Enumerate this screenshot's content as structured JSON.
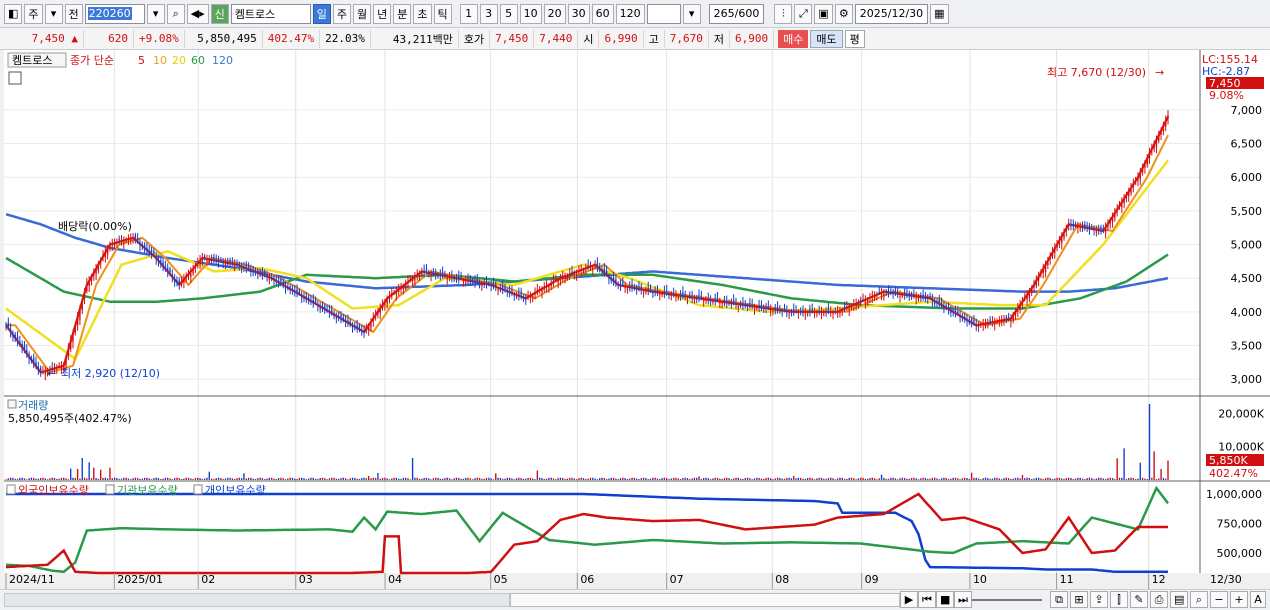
{
  "toolbar": {
    "market": "주",
    "prev": "전",
    "code": "220260",
    "stock_name": "켐트로스",
    "stock_badge": "신",
    "periods": [
      "일",
      "주",
      "월",
      "년",
      "분",
      "초",
      "틱"
    ],
    "selected_period": "일",
    "intervals": [
      "1",
      "3",
      "5",
      "10",
      "20",
      "30",
      "60",
      "120"
    ],
    "count": "265",
    "count_max": "/600",
    "date": "2025/12/30"
  },
  "quote": {
    "price": "7,450 ▲",
    "change": "620",
    "change_pct": "+9.08%",
    "volume": "5,850,495",
    "vol_ratio": "402.47%",
    "turnover": "22.03%",
    "amount": "43,211백만",
    "bid_label": "호가",
    "ask": "7,450",
    "bid": "7,440",
    "open_label": "시",
    "open": "6,990",
    "high_label": "고",
    "high": "7,670",
    "low_label": "저",
    "low": "6,900",
    "buy": "매수",
    "sell": "매도",
    "avg": "평"
  },
  "chart_data": {
    "type": "candlestick",
    "price_panel": {
      "legend": {
        "name": "켐트로스",
        "ma_label": "종가 단순",
        "ma_periods": [
          "5",
          "10",
          "20",
          "60",
          "120"
        ]
      },
      "y_ticks": [
        3000,
        3500,
        4000,
        4500,
        5000,
        5500,
        6000,
        6500,
        7000
      ],
      "ylim": [
        2750,
        7800
      ],
      "dividend_label": "배당락(0.00%)",
      "high_annotation": "최고 7,670 (12/30)",
      "low_annotation": "최저 2,920 (12/10)",
      "lc_label": "LC:155.14",
      "hc_label": "HC:-2.87",
      "last_price_label": "7,450",
      "last_pct_label": "9.08%",
      "ma5_anchors": [
        [
          0,
          3800
        ],
        [
          15,
          3100
        ],
        [
          25,
          3200
        ],
        [
          35,
          4400
        ],
        [
          45,
          5000
        ],
        [
          55,
          5100
        ],
        [
          65,
          4800
        ],
        [
          75,
          4400
        ],
        [
          85,
          4800
        ],
        [
          100,
          4700
        ],
        [
          115,
          4500
        ],
        [
          125,
          4300
        ],
        [
          140,
          4000
        ],
        [
          155,
          3700
        ],
        [
          165,
          4200
        ],
        [
          180,
          4600
        ],
        [
          195,
          4500
        ],
        [
          210,
          4400
        ],
        [
          225,
          4200
        ],
        [
          240,
          4500
        ],
        [
          255,
          4700
        ],
        [
          265,
          4400
        ],
        [
          280,
          4300
        ],
        [
          300,
          4200
        ],
        [
          320,
          4100
        ],
        [
          340,
          4000
        ],
        [
          360,
          4000
        ],
        [
          380,
          4300
        ],
        [
          400,
          4200
        ],
        [
          420,
          3800
        ],
        [
          435,
          3900
        ],
        [
          445,
          4400
        ],
        [
          460,
          5300
        ],
        [
          475,
          5200
        ],
        [
          490,
          6000
        ],
        [
          503,
          6900
        ]
      ],
      "ma20_anchors": [
        [
          0,
          4050
        ],
        [
          30,
          3300
        ],
        [
          50,
          4700
        ],
        [
          70,
          4900
        ],
        [
          90,
          4600
        ],
        [
          110,
          4650
        ],
        [
          130,
          4500
        ],
        [
          150,
          4050
        ],
        [
          170,
          4100
        ],
        [
          190,
          4500
        ],
        [
          220,
          4400
        ],
        [
          250,
          4700
        ],
        [
          270,
          4500
        ],
        [
          300,
          4100
        ],
        [
          330,
          4000
        ],
        [
          360,
          4050
        ],
        [
          400,
          4150
        ],
        [
          430,
          4100
        ],
        [
          450,
          4100
        ],
        [
          475,
          5000
        ],
        [
          503,
          6250
        ]
      ],
      "ma60_anchors": [
        [
          0,
          4800
        ],
        [
          25,
          4300
        ],
        [
          45,
          4150
        ],
        [
          65,
          4150
        ],
        [
          85,
          4200
        ],
        [
          110,
          4300
        ],
        [
          130,
          4550
        ],
        [
          160,
          4500
        ],
        [
          190,
          4550
        ],
        [
          220,
          4450
        ],
        [
          250,
          4550
        ],
        [
          280,
          4550
        ],
        [
          310,
          4400
        ],
        [
          340,
          4200
        ],
        [
          370,
          4100
        ],
        [
          410,
          4050
        ],
        [
          440,
          4050
        ],
        [
          465,
          4200
        ],
        [
          485,
          4450
        ],
        [
          503,
          4850
        ]
      ],
      "ma120_anchors": [
        [
          0,
          5450
        ],
        [
          15,
          5300
        ],
        [
          30,
          5100
        ],
        [
          45,
          4950
        ],
        [
          70,
          4800
        ],
        [
          100,
          4650
        ],
        [
          130,
          4450
        ],
        [
          160,
          4350
        ],
        [
          200,
          4400
        ],
        [
          240,
          4500
        ],
        [
          280,
          4600
        ],
        [
          320,
          4500
        ],
        [
          360,
          4400
        ],
        [
          400,
          4350
        ],
        [
          440,
          4300
        ],
        [
          460,
          4300
        ],
        [
          480,
          4350
        ],
        [
          503,
          4500
        ]
      ]
    },
    "volume_panel": {
      "title": "거래량",
      "value_label": "5,850,495주(402.47%)",
      "y_ticks": [
        10000,
        20000
      ],
      "y_tick_labels": [
        "10,000K",
        "20,000K"
      ],
      "last_label": "5,850K",
      "last_pct_label": "402.47%",
      "ylim": [
        0,
        24000
      ],
      "spikes": [
        [
          28,
          3400
        ],
        [
          31,
          3300
        ],
        [
          33,
          6600
        ],
        [
          36,
          5300
        ],
        [
          38,
          3700
        ],
        [
          41,
          3100
        ],
        [
          45,
          3700
        ],
        [
          88,
          2500
        ],
        [
          103,
          2000
        ],
        [
          161,
          2100
        ],
        [
          157,
          1200
        ],
        [
          176,
          6600
        ],
        [
          212,
          2000
        ],
        [
          230,
          2800
        ],
        [
          300,
          1100
        ],
        [
          341,
          1200
        ],
        [
          379,
          1600
        ],
        [
          418,
          2200
        ],
        [
          440,
          1500
        ],
        [
          481,
          6500
        ],
        [
          484,
          9500
        ],
        [
          491,
          5200
        ],
        [
          495,
          22800
        ],
        [
          497,
          8600
        ],
        [
          500,
          3300
        ],
        [
          503,
          5850
        ]
      ]
    },
    "holdings_panel": {
      "series_names": [
        "외국인보유수량",
        "기관보유수량",
        "개인보유수량"
      ],
      "series_colors": [
        "#d01010",
        "#2a9a4a",
        "#1040d0"
      ],
      "y_ticks": [
        500000,
        750000,
        1000000
      ],
      "y_tick_labels": [
        "500,000",
        "750,000",
        "1,000,000"
      ],
      "ylim": [
        330000,
        1110000
      ],
      "foreign_anchors": [
        [
          0,
          380000
        ],
        [
          18,
          400000
        ],
        [
          25,
          520000
        ],
        [
          30,
          340000
        ],
        [
          40,
          330000
        ],
        [
          100,
          330000
        ],
        [
          150,
          330000
        ],
        [
          163,
          340000
        ],
        [
          164,
          640000
        ],
        [
          170,
          640000
        ],
        [
          171,
          330000
        ],
        [
          200,
          330000
        ],
        [
          210,
          340000
        ],
        [
          220,
          570000
        ],
        [
          230,
          600000
        ],
        [
          240,
          780000
        ],
        [
          250,
          830000
        ],
        [
          260,
          800000
        ],
        [
          280,
          770000
        ],
        [
          300,
          780000
        ],
        [
          320,
          700000
        ],
        [
          350,
          740000
        ],
        [
          360,
          800000
        ],
        [
          380,
          830000
        ],
        [
          395,
          1000000
        ],
        [
          405,
          780000
        ],
        [
          415,
          800000
        ],
        [
          430,
          700000
        ],
        [
          440,
          500000
        ],
        [
          450,
          530000
        ],
        [
          460,
          800000
        ],
        [
          470,
          500000
        ],
        [
          480,
          520000
        ],
        [
          490,
          720000
        ],
        [
          503,
          720000
        ]
      ],
      "foreign_note": "foreign holdings",
      "institution_anchors": [
        [
          0,
          400000
        ],
        [
          10,
          390000
        ],
        [
          20,
          350000
        ],
        [
          25,
          340000
        ],
        [
          30,
          420000
        ],
        [
          35,
          690000
        ],
        [
          50,
          710000
        ],
        [
          70,
          700000
        ],
        [
          100,
          690000
        ],
        [
          140,
          700000
        ],
        [
          150,
          680000
        ],
        [
          155,
          800000
        ],
        [
          160,
          700000
        ],
        [
          165,
          850000
        ],
        [
          180,
          830000
        ],
        [
          195,
          860000
        ],
        [
          205,
          600000
        ],
        [
          215,
          840000
        ],
        [
          235,
          610000
        ],
        [
          255,
          570000
        ],
        [
          280,
          610000
        ],
        [
          310,
          580000
        ],
        [
          340,
          590000
        ],
        [
          370,
          580000
        ],
        [
          400,
          510000
        ],
        [
          410,
          500000
        ],
        [
          420,
          580000
        ],
        [
          440,
          600000
        ],
        [
          460,
          580000
        ],
        [
          470,
          800000
        ],
        [
          480,
          750000
        ],
        [
          490,
          700000
        ],
        [
          498,
          1050000
        ],
        [
          503,
          920000
        ]
      ],
      "individual_anchors": [
        [
          0,
          1000000
        ],
        [
          100,
          1000000
        ],
        [
          200,
          1000000
        ],
        [
          250,
          1000000
        ],
        [
          300,
          960000
        ],
        [
          350,
          940000
        ],
        [
          360,
          920000
        ],
        [
          362,
          840000
        ],
        [
          385,
          840000
        ],
        [
          392,
          770000
        ],
        [
          395,
          660000
        ],
        [
          398,
          440000
        ],
        [
          400,
          380000
        ],
        [
          440,
          370000
        ],
        [
          450,
          360000
        ],
        [
          460,
          360000
        ],
        [
          470,
          360000
        ],
        [
          480,
          340000
        ],
        [
          503,
          340000
        ]
      ]
    },
    "x_axis": {
      "labels": [
        "2024/11",
        "2025/01",
        "02",
        "03",
        "04",
        "05",
        "06",
        "07",
        "08",
        "09",
        "10",
        "11",
        "12"
      ],
      "label_positions": [
        0,
        40,
        71,
        107,
        140,
        179,
        211,
        244,
        283,
        316,
        356,
        388,
        422
      ],
      "right_label": "12/30",
      "total_bars": 504
    }
  }
}
